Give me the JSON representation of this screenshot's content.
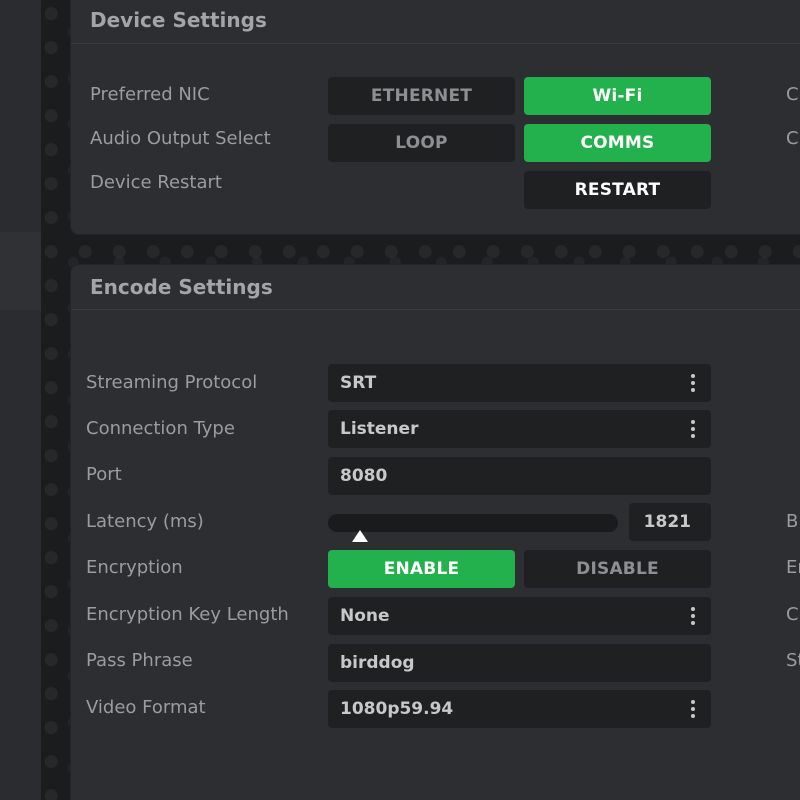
{
  "device_settings": {
    "title": "Device Settings",
    "rows": {
      "preferred_nic": {
        "label": "Preferred NIC",
        "options": [
          "ETHERNET",
          "Wi-Fi"
        ],
        "selected": "Wi-Fi"
      },
      "audio_output": {
        "label": "Audio Output Select",
        "options": [
          "LOOP",
          "COMMS"
        ],
        "selected": "COMMS"
      },
      "device_restart": {
        "label": "Device Restart",
        "button": "RESTART"
      }
    },
    "clipped_right": [
      "C",
      "C"
    ]
  },
  "encode_settings": {
    "title": "Encode Settings",
    "streaming_protocol": {
      "label": "Streaming Protocol",
      "value": "SRT"
    },
    "connection_type": {
      "label": "Connection Type",
      "value": "Listener"
    },
    "port": {
      "label": "Port",
      "value": "8080"
    },
    "latency": {
      "label": "Latency (ms)",
      "value": "1821",
      "slider_fraction": 0.1
    },
    "encryption": {
      "label": "Encryption",
      "options": [
        "ENABLE",
        "DISABLE"
      ],
      "selected": "ENABLE"
    },
    "encryption_key_length": {
      "label": "Encryption Key Length",
      "value": "None"
    },
    "pass_phrase": {
      "label": "Pass Phrase",
      "value": "birddog"
    },
    "video_format": {
      "label": "Video Format",
      "value": "1080p59.94"
    },
    "clipped_right": [
      "B",
      "Er",
      "C",
      "St"
    ]
  },
  "colors": {
    "accent_green": "#22b14c",
    "panel_bg": "#2c2e31",
    "control_bg": "#1f2022"
  }
}
